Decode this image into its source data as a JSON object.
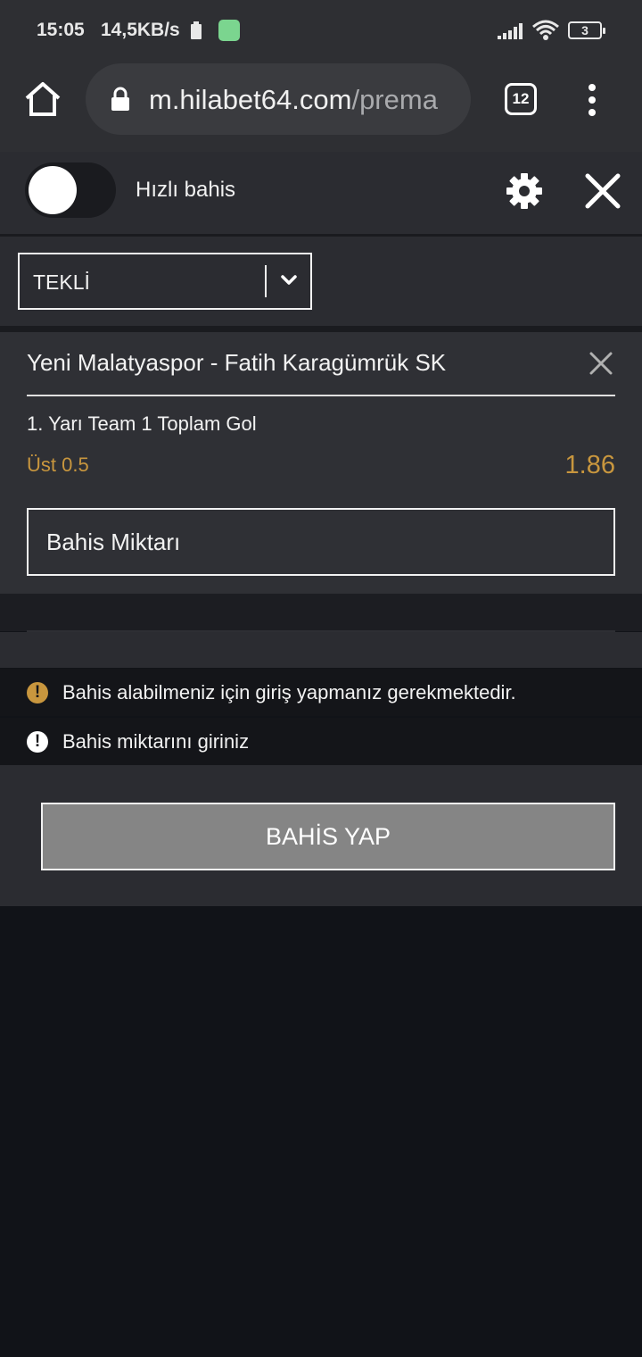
{
  "status_bar": {
    "time": "15:05",
    "net_speed": "14,5KB/s",
    "battery_level": "3"
  },
  "browser": {
    "url_domain": "m.hilabet64.com",
    "url_path": "/prema",
    "tab_count": "12"
  },
  "slip": {
    "quick_bet_label": "Hızlı bahis",
    "bet_type": "TEKLİ"
  },
  "bet": {
    "match": "Yeni Malatyaspor - Fatih Karagümrük SK",
    "market": "1. Yarı Team 1 Toplam Gol",
    "selection": "Üst 0.5",
    "odds": "1.86",
    "stake_placeholder": "Bahis Miktarı"
  },
  "messages": [
    {
      "icon": "warning-icon",
      "text": "Bahis alabilmeniz için giriş yapmanız gerekmektedir.",
      "color": "#c8963e"
    },
    {
      "icon": "alert-icon",
      "text": "Bahis miktarını giriniz",
      "color": "#ffffff"
    }
  ],
  "actions": {
    "submit_label": "BAHİS YAP"
  },
  "colors": {
    "accent": "#c8963e",
    "button_disabled": "#858585"
  }
}
